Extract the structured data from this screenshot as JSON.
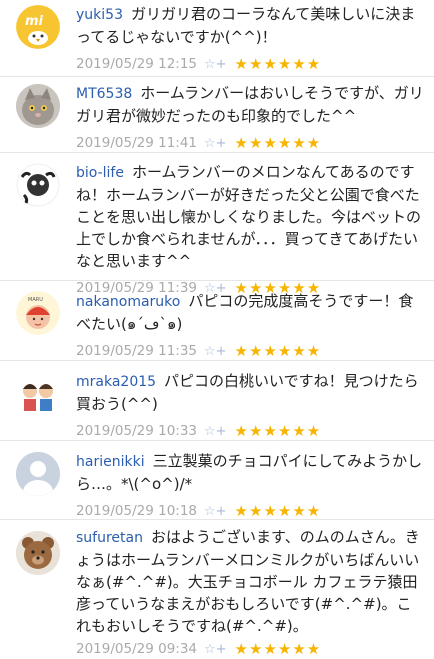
{
  "comments": [
    {
      "user": "yuki53",
      "text": "ガリガリ君のコーラなんて美味しいに決まってるじゃないですか(^^)！",
      "time": "2019/05/29 12:15",
      "stars": "★★★★★★"
    },
    {
      "user": "MT6538",
      "text": "ホームランバーはおいしそうですが、ガリガリ君が微妙だったのも印象的でした^^",
      "time": "2019/05/29 11:41",
      "stars": "★★★★★★"
    },
    {
      "user": "bio-life",
      "text": "ホームランバーのメロンなんてあるのですね！ホームランバーが好きだった父と公園で食べたことを思い出し懐かしくなりました。今はベットの上でしか食べられませんが．．．買ってきてあげたいなと思います^^",
      "time": "2019/05/29 11:39",
      "stars": "★★★★★★"
    },
    {
      "user": "nakanomaruko",
      "text": "パピコの完成度高そうですー！食べたい(๑´ڡ`๑)",
      "time": "2019/05/29 11:35",
      "stars": "★★★★★★"
    },
    {
      "user": "mraka2015",
      "text": "パピコの白桃いいですね！見つけたら買おう(^^)",
      "time": "2019/05/29 10:33",
      "stars": "★★★★★★"
    },
    {
      "user": "harienikki",
      "text": "三立製菓のチョコパイにしてみようかしら…。*\\(^o^)/*",
      "time": "2019/05/29 10:18",
      "stars": "★★★★★★"
    },
    {
      "user": "sufuretan",
      "text": "おはようございます、のムのムさん。きょうはホームランバーメロンミルクがいちばんいいなぁ(#^.^#)。大玉チョコボール カフェラテ猿田彦っていうなまえがおもしろいです(#^.^#)。これもおいしそうですね(#^.^#)。",
      "time": "2019/05/29 09:34",
      "stars": "★★★★★★"
    }
  ]
}
